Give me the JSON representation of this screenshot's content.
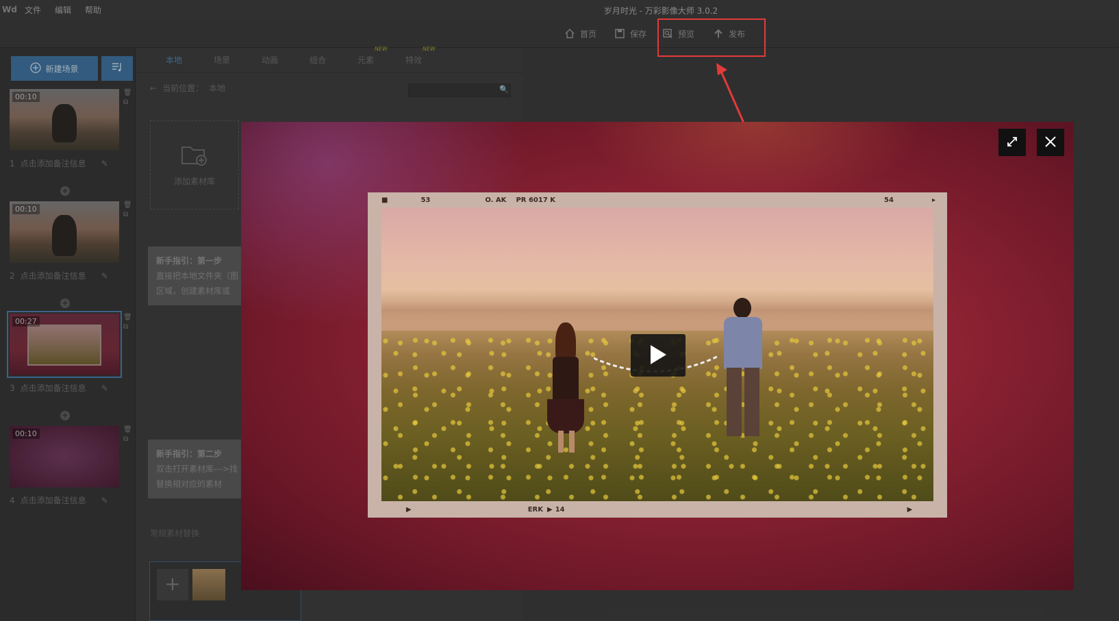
{
  "app": {
    "logo": "Wd",
    "title": "岁月时光 - 万彩影像大师 3.0.2",
    "menu": [
      "文件",
      "编辑",
      "帮助"
    ]
  },
  "toolbar": {
    "home_label": "首页",
    "save_label": "保存",
    "preview_label": "预览",
    "publish_label": "发布"
  },
  "scenes": {
    "new_scene_label": "新建场景",
    "items": [
      {
        "index": "1",
        "duration": "00:10",
        "note": "点击添加备注信息"
      },
      {
        "index": "2",
        "duration": "00:10",
        "note": "点击添加备注信息"
      },
      {
        "index": "3",
        "duration": "00:27",
        "note": "点击添加备注信息"
      },
      {
        "index": "4",
        "duration": "00:10",
        "note": "点击添加备注信息"
      }
    ]
  },
  "library": {
    "tabs": [
      "本地",
      "场景",
      "动画",
      "组合",
      "元素",
      "特效"
    ],
    "new_badge": "NEW",
    "crumb_label": "当前位置：",
    "crumb_value": "本地",
    "add_library_label": "添加素材库",
    "guide1": {
      "title": "新手指引：第一步",
      "line1": "直接把本地文件夹（图",
      "line2": "区域，创建素材库或"
    },
    "guide2": {
      "title": "新手指引：第二步",
      "line1": "双击打开素材库--->找",
      "line2": "替换相对应的素材"
    },
    "bottom_tab": "常规素材替换"
  },
  "preview": {
    "film_top": {
      "left": "53",
      "mid1": "O. AK",
      "mid2": "PR 6017 K",
      "right": "54"
    },
    "film_bottom": {
      "mid": "ERK",
      "num": "14"
    }
  },
  "colors": {
    "accent": "#3d6f9b",
    "highlight": "#e33a3a",
    "modal_bg": "#8c2233"
  }
}
